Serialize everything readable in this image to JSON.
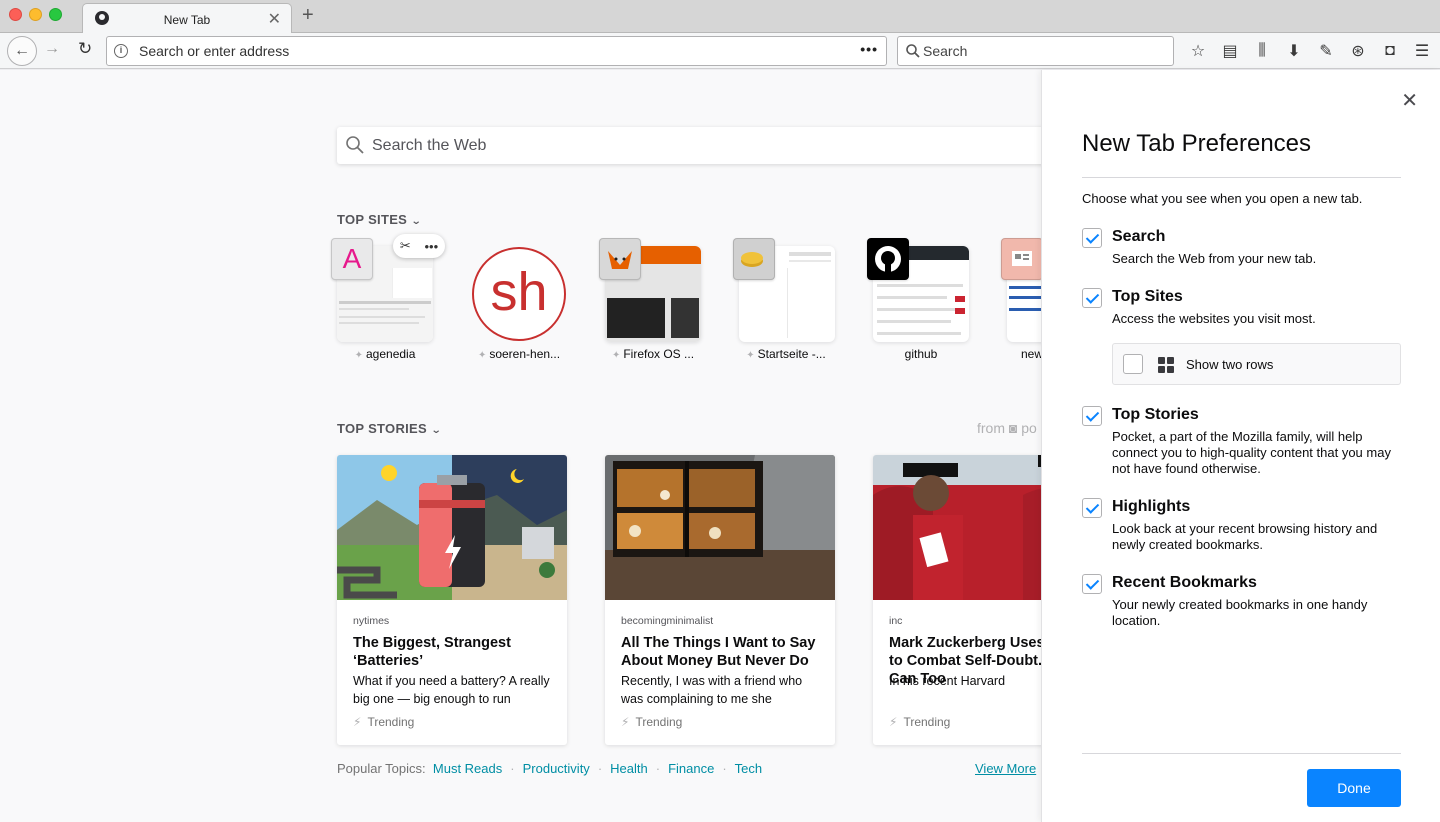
{
  "browser": {
    "tab_title": "New Tab",
    "url_placeholder": "Search or enter address",
    "search_placeholder": "Search"
  },
  "newtab": {
    "search_placeholder": "Search the Web",
    "top_sites_title": "TOP SITES",
    "top_sites": [
      {
        "label": "agenedia",
        "icon_letter": "A"
      },
      {
        "label": "soeren-hen...",
        "icon_letter": "sh"
      },
      {
        "label": "Firefox OS ..."
      },
      {
        "label": "Startseite -..."
      },
      {
        "label": "github"
      },
      {
        "label": "new"
      }
    ],
    "top_stories_title": "TOP STORIES",
    "from_label": "from",
    "stories": [
      {
        "source": "nytimes",
        "title": "The Biggest, Strangest ‘Batteries’",
        "desc": "What if you need a battery? A really big one — big enough to run",
        "context": "Trending"
      },
      {
        "source": "becomingminimalist",
        "title": "All The Things I Want to Say About Money But Never Do",
        "desc": "Recently, I was with a friend who was complaining to me she",
        "context": "Trending"
      },
      {
        "source": "inc",
        "title": "Mark Zuckerberg Uses Trick to Combat Self-Doubt. You Can Too",
        "desc": "In his recent Harvard",
        "context": "Trending"
      }
    ],
    "topics_label": "Popular Topics:",
    "topics": [
      "Must Reads",
      "Productivity",
      "Health",
      "Finance",
      "Tech"
    ],
    "view_more": "View More"
  },
  "prefs": {
    "title": "New Tab Preferences",
    "intro": "Choose what you see when you open a new tab.",
    "items": [
      {
        "label": "Search",
        "desc": "Search the Web from your new tab.",
        "checked": true
      },
      {
        "label": "Top Sites",
        "desc": "Access the websites you visit most.",
        "checked": true
      },
      {
        "label": "Top Stories",
        "desc": "Pocket, a part of the Mozilla family, will help connect you to high-quality content that you may not have found otherwise.",
        "checked": true
      },
      {
        "label": "Highlights",
        "desc": "Look back at your recent browsing history and newly created bookmarks.",
        "checked": true
      },
      {
        "label": "Recent Bookmarks",
        "desc": "Your newly created bookmarks in one handy location.",
        "checked": true
      }
    ],
    "two_rows_label": "Show two rows",
    "two_rows_checked": false,
    "done_label": "Done"
  },
  "colors": {
    "accent": "#0a84ff",
    "link": "#008ea4"
  }
}
